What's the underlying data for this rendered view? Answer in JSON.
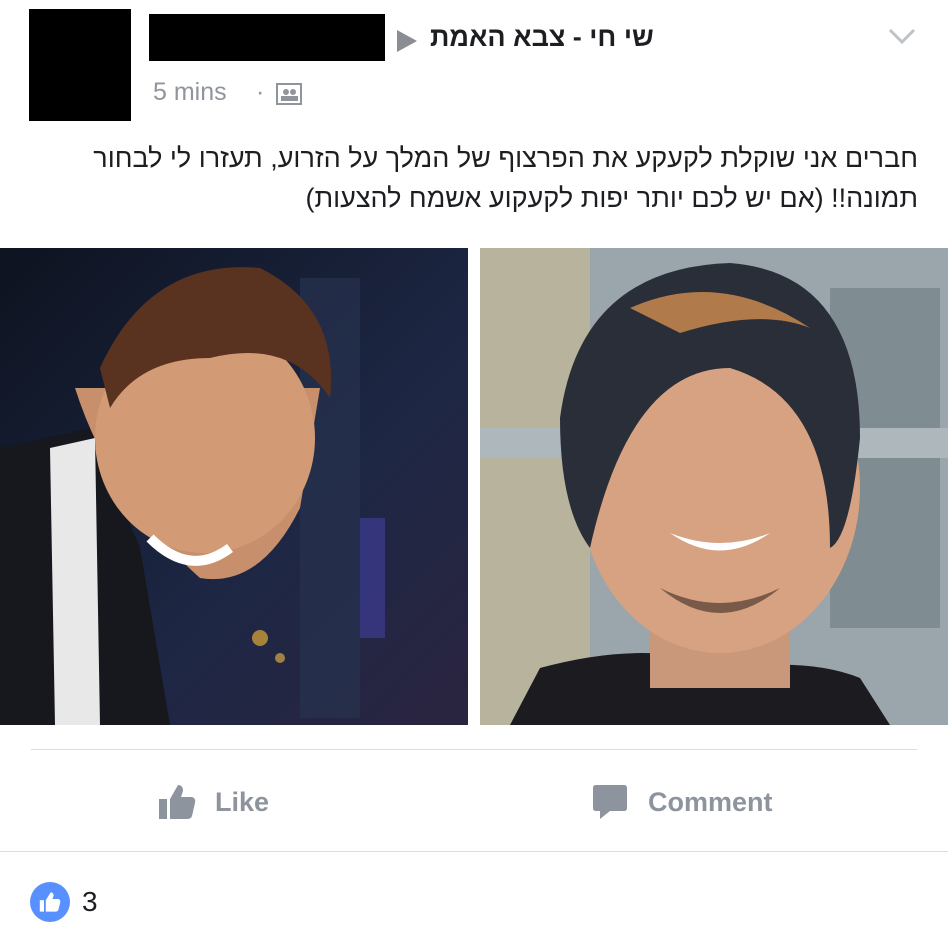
{
  "post": {
    "author_name": "",
    "group_name": "שי חי - צבא האמת",
    "timestamp": "5 mins",
    "separator": "·",
    "privacy_icon": "group-audience-icon",
    "text": "חברים אני שוקלת לקעקע את הפרצוף של המלך על הזרוע, תעזרו לי לבחור תמונה!! (אם יש לכם יותר יפות לקעקוע אשמח להצעות)",
    "photos": [
      {
        "description": "smiling man in dark suit, side view"
      },
      {
        "description": "smiling man in dark beanie"
      }
    ]
  },
  "actions": {
    "like_label": "Like",
    "comment_label": "Comment"
  },
  "reactions": {
    "count": "3",
    "icon": "thumbs-up-icon"
  },
  "colors": {
    "accent": "#5890ff",
    "muted": "#8d949e",
    "text": "#1c1e21"
  }
}
